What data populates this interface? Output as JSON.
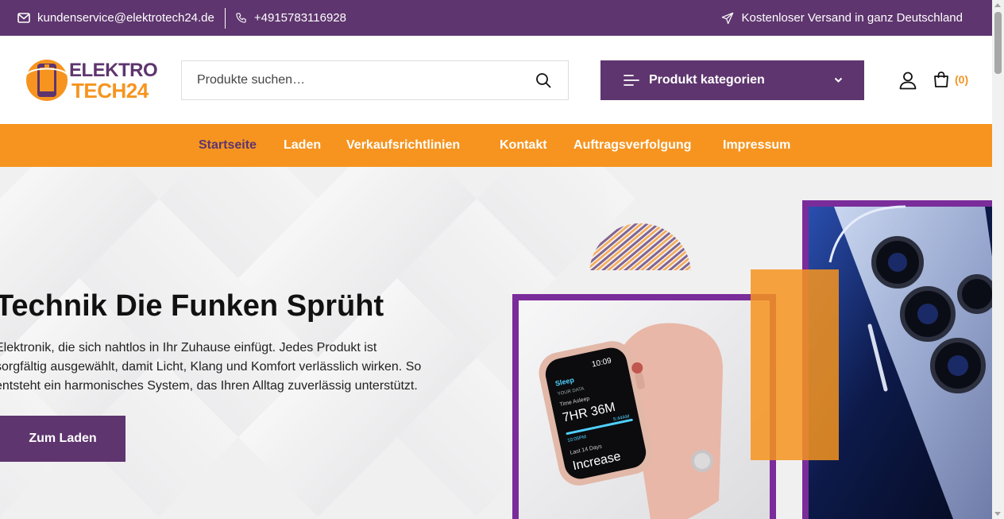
{
  "topbar": {
    "email": "kundenservice@elektrotech24.de",
    "phone": "+4915783116928",
    "shipping": "Kostenloser Versand in ganz Deutschland"
  },
  "logo": {
    "line1": "ELEKTRO",
    "line2": "TECH24"
  },
  "search": {
    "placeholder": "Produkte suchen…"
  },
  "categories": {
    "label": "Produkt kategorien"
  },
  "cart": {
    "count": "(0)"
  },
  "nav": {
    "items": [
      {
        "label": "Startseite"
      },
      {
        "label": "Laden"
      },
      {
        "label": "Verkaufsrichtlinien"
      },
      {
        "label": "Kontakt"
      },
      {
        "label": "Auftragsverfolgung"
      },
      {
        "label": "Impressum"
      }
    ]
  },
  "hero": {
    "title": "Technik Die Funken Sprüht",
    "text": "Elektronik, die sich nahtlos in Ihr Zuhause einfügt. Jedes Produkt ist sorgfältig ausgewählt, damit Licht, Klang und Komfort verlässlich wirken. So entsteht ein harmonisches System, das Ihren Alltag zuverlässig unterstützt.",
    "button": "Zum Laden",
    "watch": {
      "time": "10:09",
      "app": "Sleep",
      "subtitle": "YOUR DATA",
      "metric_label": "Time Asleep",
      "metric_value": "7HR 36M",
      "side_value": "5:44AM",
      "start_time": "10:05PM",
      "period": "Last 14 Days",
      "trend": "Increase"
    }
  },
  "colors": {
    "purple": "#5e356e",
    "orange": "#f6941f"
  },
  "icons": [
    "mail-icon",
    "phone-icon",
    "paper-plane-icon",
    "search-icon",
    "menu-lines-icon",
    "chevron-down-icon",
    "user-icon",
    "shopping-bag-icon"
  ]
}
